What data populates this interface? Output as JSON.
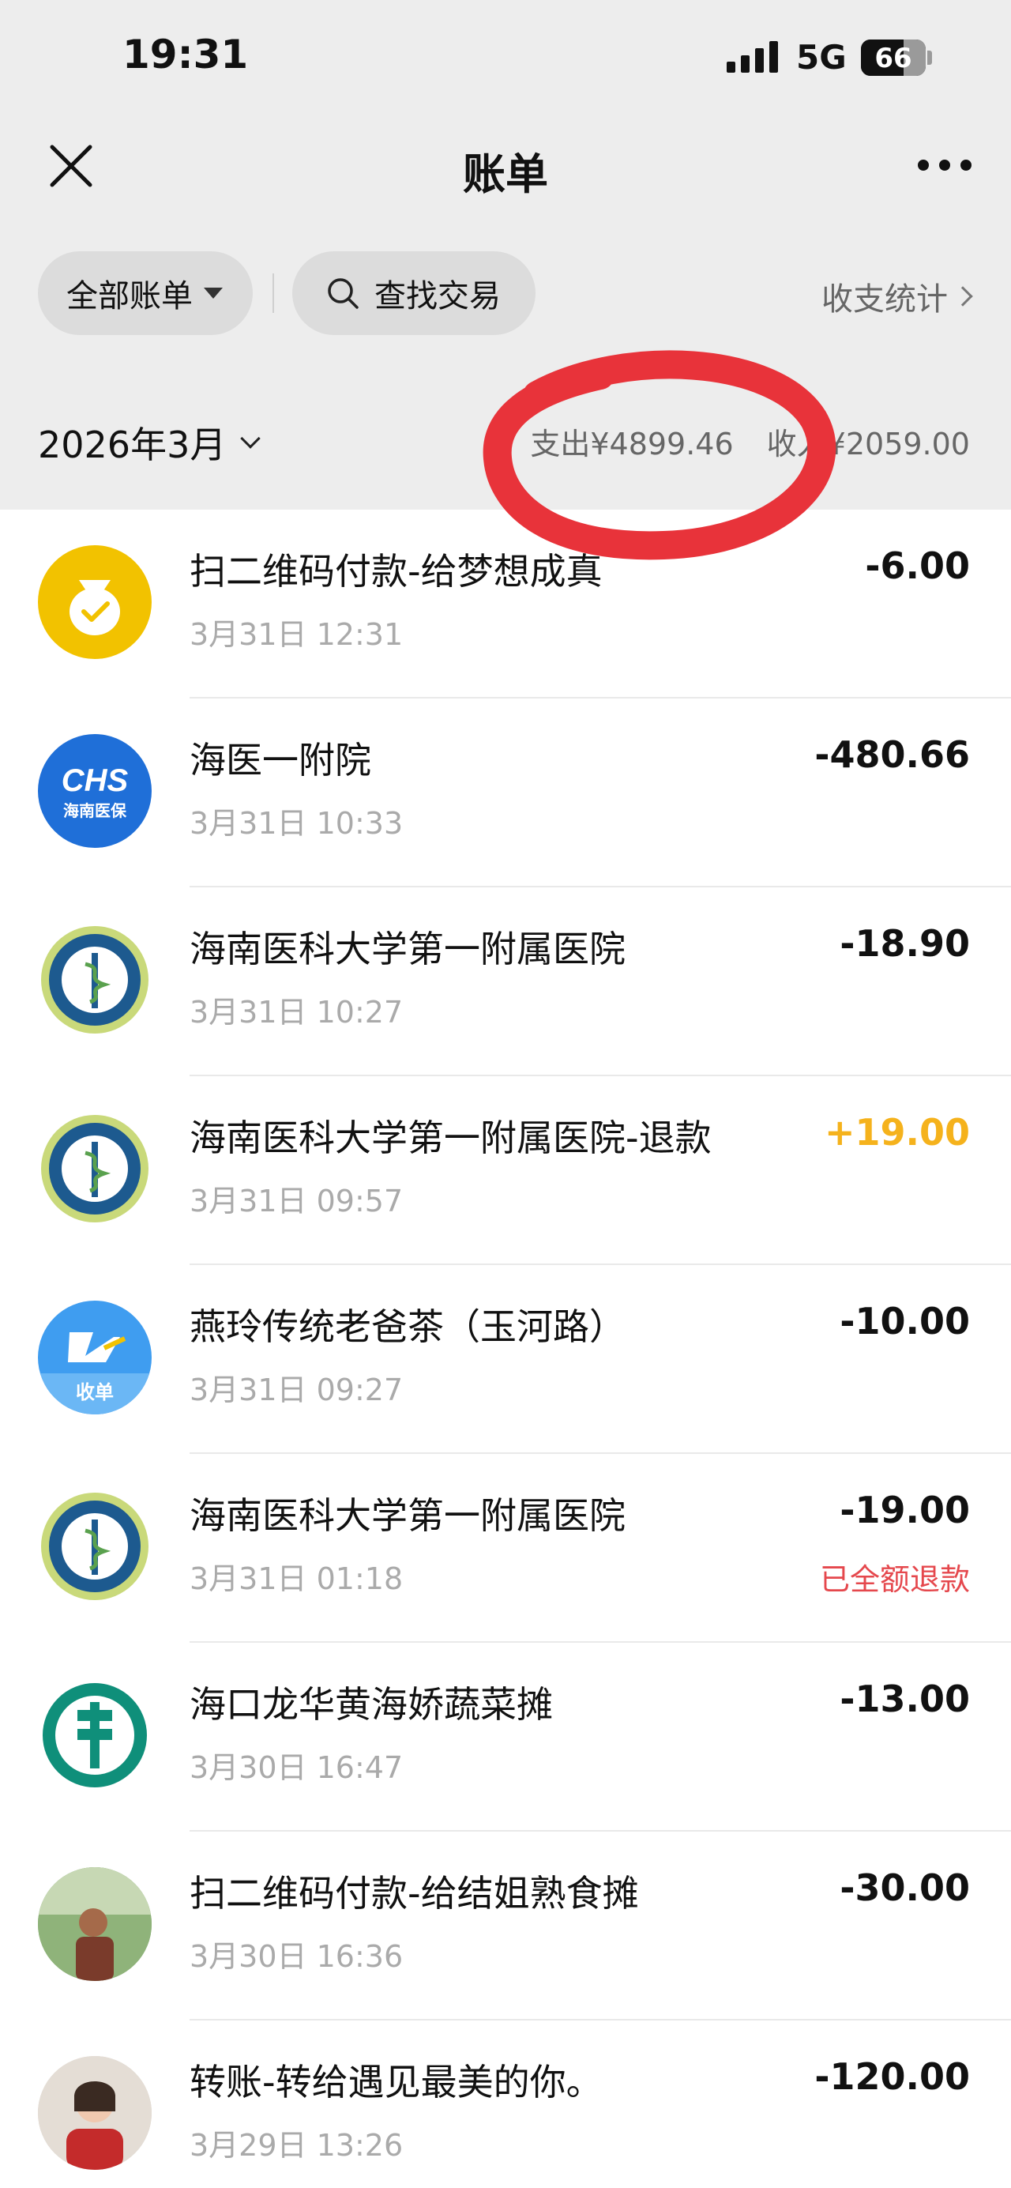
{
  "status_bar": {
    "time": "19:31",
    "network": "5G",
    "battery": "66",
    "battery_level": 0.66
  },
  "header": {
    "title": "账单"
  },
  "filters": {
    "all_bills": "全部账单",
    "search": "查找交易",
    "stats": "收支统计"
  },
  "summary": {
    "month": "2026年3月",
    "expense": "支出¥4899.46",
    "income": "收入¥2059.00"
  },
  "transactions": [
    {
      "title": "扫二维码付款-给梦想成真",
      "time": "3月31日 12:31",
      "amount": "-6.00",
      "icon": "money-bag-icon"
    },
    {
      "title": "海医一附院",
      "time": "3月31日 10:33",
      "amount": "-480.66",
      "icon": "chs-medical-insurance-logo",
      "logo_text_top": "CHS",
      "logo_text_bottom": "海南医保"
    },
    {
      "title": "海南医科大学第一附属医院",
      "time": "3月31日 10:27",
      "amount": "-18.90",
      "icon": "hospital-emblem"
    },
    {
      "title": "海南医科大学第一附属医院-退款",
      "time": "3月31日 09:57",
      "amount": "+19.00",
      "icon": "hospital-emblem"
    },
    {
      "title": "燕玲传统老爸茶（玉河路）",
      "time": "3月31日 09:27",
      "amount": "-10.00",
      "icon": "shoubei-logo",
      "logo_text_bottom": "收单"
    },
    {
      "title": "海南医科大学第一附属医院",
      "time": "3月31日 01:18",
      "amount": "-19.00",
      "status": "已全额退款",
      "icon": "hospital-emblem"
    },
    {
      "title": "海口龙华黄海娇蔬菜摊",
      "time": "3月30日 16:47",
      "amount": "-13.00",
      "icon": "bank-logo"
    },
    {
      "title": "扫二维码付款-给结姐熟食摊",
      "time": "3月30日 16:36",
      "amount": "-30.00",
      "icon": "user-photo-avatar"
    },
    {
      "title": "转账-转给遇见最美的你。",
      "time": "3月29日 13:26",
      "amount": "-120.00",
      "icon": "user-photo-avatar"
    }
  ],
  "colors": {
    "positive": "#f5b21c",
    "refund_status": "#e5484d",
    "annotation": "#e8333a"
  }
}
